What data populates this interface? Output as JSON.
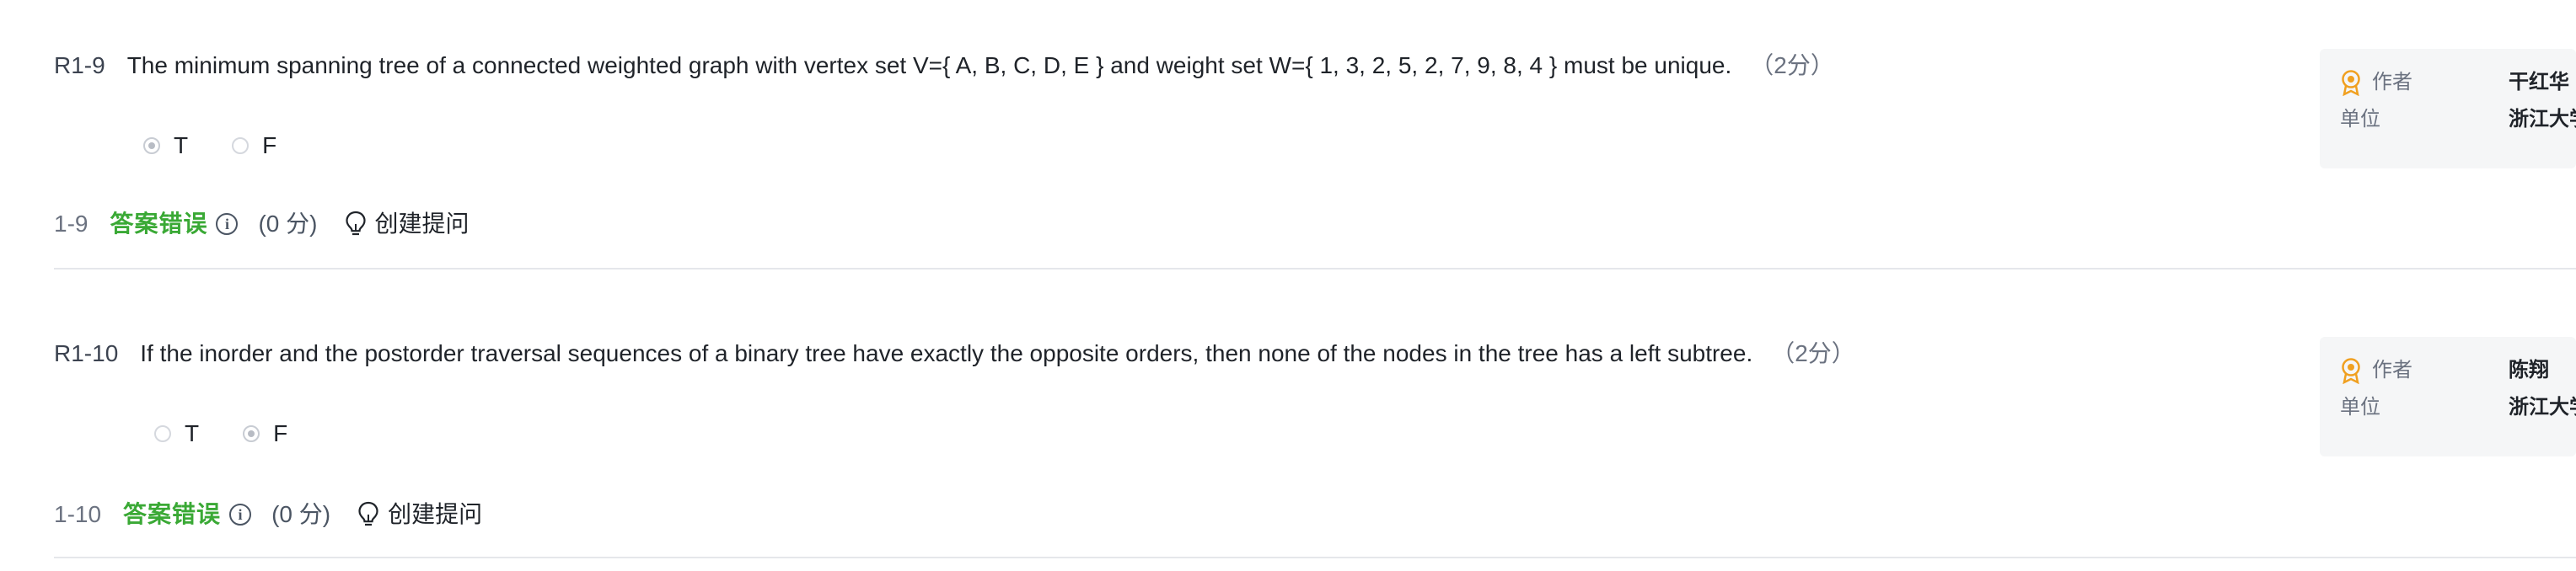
{
  "problems": [
    {
      "id": "R1-9",
      "text": "The minimum spanning tree of a connected weighted graph with vertex set V={ A, B, C, D, E } and weight set W={ 1, 3, 2, 5, 2, 7, 9, 8, 4 } must be unique.",
      "score": "（2分）",
      "options": [
        {
          "label": "T",
          "selected": true
        },
        {
          "label": "F",
          "selected": false
        }
      ],
      "result": {
        "number": "1-9",
        "status": "答案错误",
        "points": "(0 分)",
        "ask_label": "创建提问"
      },
      "author": {
        "author_key": "作者",
        "author_val": "干红华",
        "unit_key": "单位",
        "unit_val": "浙江大学"
      }
    },
    {
      "id": "R1-10",
      "text": "If the inorder and the postorder traversal sequences of a binary tree have exactly the opposite orders, then none of the nodes in the tree has a left subtree.",
      "score": "（2分）",
      "options": [
        {
          "label": "T",
          "selected": false
        },
        {
          "label": "F",
          "selected": true
        }
      ],
      "result": {
        "number": "1-10",
        "status": "答案错误",
        "points": "(0 分)",
        "ask_label": "创建提问"
      },
      "author": {
        "author_key": "作者",
        "author_val": "陈翔",
        "unit_key": "单位",
        "unit_val": "浙江大学"
      }
    }
  ],
  "icons": {
    "status_color": "#3aa935",
    "medal_color": "#f0a020",
    "info_icon": "info-circle-icon",
    "bulb_icon": "lightbulb-icon",
    "medal_icon": "medal-icon"
  }
}
